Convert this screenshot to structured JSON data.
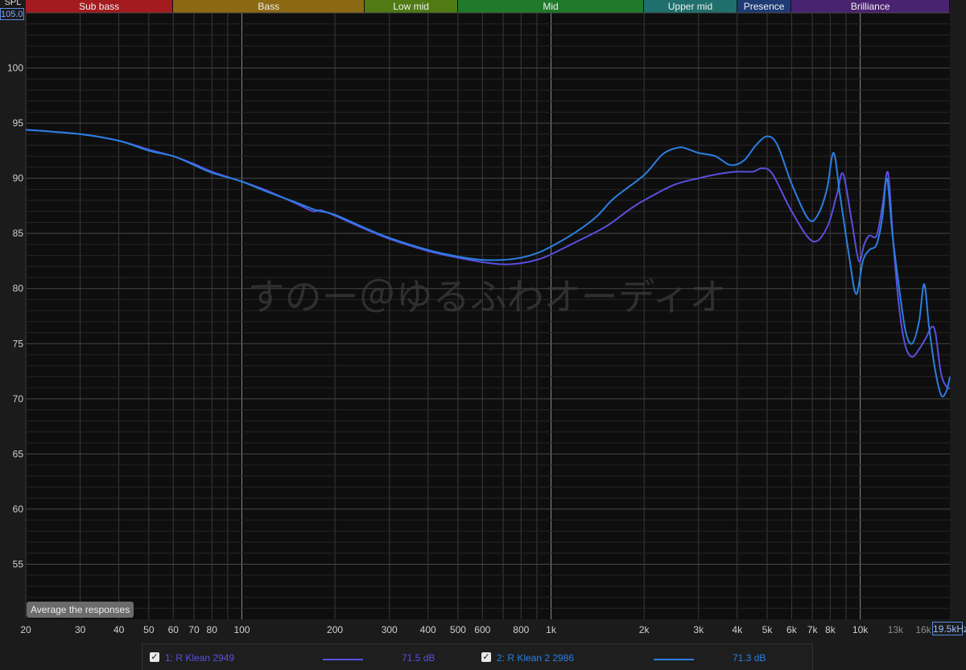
{
  "header": {
    "spl_label": "SPL",
    "y_max_box": "105.00"
  },
  "bands": [
    {
      "name": "Sub bass",
      "color": "#a31b1f",
      "from": 20,
      "to": 60
    },
    {
      "name": "Bass",
      "color": "#8c6a14",
      "from": 60,
      "to": 250
    },
    {
      "name": "Low mid",
      "color": "#4f7a14",
      "from": 250,
      "to": 500
    },
    {
      "name": "Mid",
      "color": "#1f7a2a",
      "from": 500,
      "to": 2000
    },
    {
      "name": "Upper mid",
      "color": "#1f6f6c",
      "from": 2000,
      "to": 4000
    },
    {
      "name": "Presence",
      "color": "#1f3a74",
      "from": 4000,
      "to": 6000
    },
    {
      "name": "Brilliance",
      "color": "#4a2370",
      "from": 6000,
      "to": 20000
    }
  ],
  "watermark": "すのー＠ゆるふわオーディオ",
  "controls": {
    "average_button": "Average the responses",
    "x_max_box": "19.5kHz"
  },
  "legend": [
    {
      "check": "✓",
      "name": "1: R Klean 2949",
      "value": "71.5 dB",
      "color": "#5a4fe0"
    },
    {
      "check": "✓",
      "name": "2: R Klean 2 2986",
      "value": "71.3 dB",
      "color": "#2a7fe0"
    }
  ],
  "chart_data": {
    "type": "line",
    "x_scale": "log",
    "xlim": [
      20,
      19500
    ],
    "ylim": [
      50,
      105
    ],
    "grid": true,
    "x_ticks": [
      {
        "v": 20,
        "label": "20"
      },
      {
        "v": 30,
        "label": "30"
      },
      {
        "v": 40,
        "label": "40"
      },
      {
        "v": 50,
        "label": "50"
      },
      {
        "v": 60,
        "label": "60"
      },
      {
        "v": 70,
        "label": "70"
      },
      {
        "v": 80,
        "label": "80"
      },
      {
        "v": 100,
        "label": "100"
      },
      {
        "v": 200,
        "label": "200"
      },
      {
        "v": 300,
        "label": "300"
      },
      {
        "v": 400,
        "label": "400"
      },
      {
        "v": 500,
        "label": "500"
      },
      {
        "v": 600,
        "label": "600"
      },
      {
        "v": 800,
        "label": "800"
      },
      {
        "v": 1000,
        "label": "1k"
      },
      {
        "v": 2000,
        "label": "2k"
      },
      {
        "v": 3000,
        "label": "3k"
      },
      {
        "v": 4000,
        "label": "4k"
      },
      {
        "v": 5000,
        "label": "5k"
      },
      {
        "v": 6000,
        "label": "6k"
      },
      {
        "v": 7000,
        "label": "7k"
      },
      {
        "v": 8000,
        "label": "8k"
      },
      {
        "v": 10000,
        "label": "10k"
      },
      {
        "v": 13000,
        "label": "13k"
      },
      {
        "v": 16000,
        "label": "16k"
      }
    ],
    "y_ticks": [
      55,
      60,
      65,
      70,
      75,
      80,
      85,
      90,
      95,
      100
    ],
    "series": [
      {
        "name": "1: R Klean 2949",
        "color": "#5a4fe0",
        "points": [
          [
            20,
            94.4
          ],
          [
            30,
            94.0
          ],
          [
            40,
            93.4
          ],
          [
            50,
            92.6
          ],
          [
            60,
            92.0
          ],
          [
            70,
            91.3
          ],
          [
            80,
            90.6
          ],
          [
            100,
            89.7
          ],
          [
            120,
            88.9
          ],
          [
            150,
            87.7
          ],
          [
            170,
            87.0
          ],
          [
            180,
            87.1
          ],
          [
            200,
            86.6
          ],
          [
            250,
            85.4
          ],
          [
            300,
            84.5
          ],
          [
            400,
            83.4
          ],
          [
            500,
            82.8
          ],
          [
            600,
            82.4
          ],
          [
            700,
            82.2
          ],
          [
            800,
            82.3
          ],
          [
            900,
            82.6
          ],
          [
            1000,
            83.1
          ],
          [
            1200,
            84.2
          ],
          [
            1500,
            85.6
          ],
          [
            1800,
            87.2
          ],
          [
            2000,
            88.0
          ],
          [
            2500,
            89.4
          ],
          [
            3000,
            90.0
          ],
          [
            3500,
            90.4
          ],
          [
            4000,
            90.6
          ],
          [
            4500,
            90.6
          ],
          [
            4800,
            90.9
          ],
          [
            5200,
            90.4
          ],
          [
            6000,
            87.0
          ],
          [
            7000,
            84.3
          ],
          [
            7800,
            85.5
          ],
          [
            8400,
            88.5
          ],
          [
            8800,
            90.4
          ],
          [
            9400,
            86.0
          ],
          [
            9900,
            82.5
          ],
          [
            10300,
            84.0
          ],
          [
            10700,
            84.8
          ],
          [
            11300,
            84.8
          ],
          [
            11800,
            87.5
          ],
          [
            12300,
            90.5
          ],
          [
            12800,
            84.0
          ],
          [
            13400,
            78.0
          ],
          [
            14000,
            74.8
          ],
          [
            14700,
            73.8
          ],
          [
            15500,
            74.5
          ],
          [
            16300,
            75.5
          ],
          [
            17000,
            76.5
          ],
          [
            17500,
            76.0
          ],
          [
            18200,
            72.5
          ],
          [
            18800,
            71.3
          ],
          [
            19500,
            70.9
          ]
        ]
      },
      {
        "name": "2: R Klean 2 2986",
        "color": "#2a7fe0",
        "points": [
          [
            20,
            94.4
          ],
          [
            30,
            94.0
          ],
          [
            40,
            93.4
          ],
          [
            50,
            92.5
          ],
          [
            60,
            92.0
          ],
          [
            70,
            91.2
          ],
          [
            80,
            90.5
          ],
          [
            100,
            89.7
          ],
          [
            120,
            88.8
          ],
          [
            150,
            87.8
          ],
          [
            170,
            87.2
          ],
          [
            180,
            87.0
          ],
          [
            200,
            86.7
          ],
          [
            250,
            85.5
          ],
          [
            300,
            84.6
          ],
          [
            400,
            83.5
          ],
          [
            500,
            82.9
          ],
          [
            600,
            82.6
          ],
          [
            700,
            82.6
          ],
          [
            800,
            82.8
          ],
          [
            900,
            83.2
          ],
          [
            1000,
            83.8
          ],
          [
            1200,
            85.1
          ],
          [
            1400,
            86.5
          ],
          [
            1600,
            88.2
          ],
          [
            2000,
            90.3
          ],
          [
            2300,
            92.2
          ],
          [
            2600,
            92.8
          ],
          [
            2800,
            92.6
          ],
          [
            3000,
            92.3
          ],
          [
            3400,
            92.0
          ],
          [
            3800,
            91.2
          ],
          [
            4200,
            91.6
          ],
          [
            4600,
            93.0
          ],
          [
            5000,
            93.8
          ],
          [
            5400,
            93.0
          ],
          [
            6000,
            89.5
          ],
          [
            6800,
            86.3
          ],
          [
            7300,
            86.7
          ],
          [
            7800,
            89.0
          ],
          [
            8200,
            92.3
          ],
          [
            8600,
            88.5
          ],
          [
            9200,
            83.0
          ],
          [
            9700,
            79.5
          ],
          [
            10200,
            82.5
          ],
          [
            10700,
            83.5
          ],
          [
            11300,
            84.0
          ],
          [
            11800,
            86.5
          ],
          [
            12200,
            90.0
          ],
          [
            12700,
            85.0
          ],
          [
            13300,
            80.5
          ],
          [
            14000,
            76.2
          ],
          [
            14700,
            75.0
          ],
          [
            15500,
            77.0
          ],
          [
            16100,
            80.4
          ],
          [
            16700,
            76.5
          ],
          [
            17500,
            72.5
          ],
          [
            18300,
            70.3
          ],
          [
            19000,
            70.7
          ],
          [
            19500,
            72.0
          ]
        ]
      }
    ]
  }
}
